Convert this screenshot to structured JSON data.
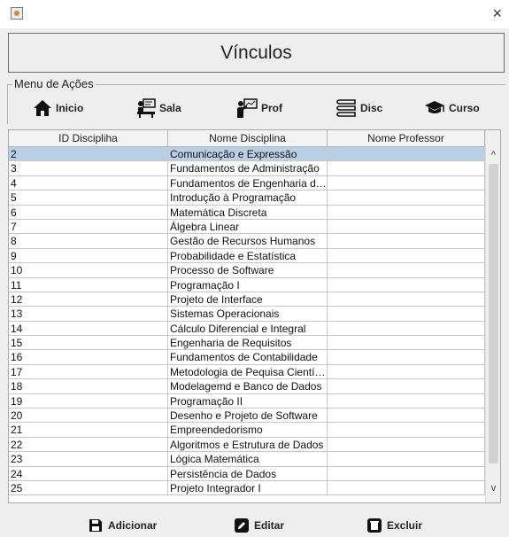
{
  "window": {
    "title": "Vínculos",
    "close_glyph": "×",
    "icon": "java-app-icon"
  },
  "menu": {
    "legend": "Menu de Ações",
    "buttons": [
      {
        "label": "Inicio",
        "icon": "home-icon"
      },
      {
        "label": "Sala",
        "icon": "classroom-icon"
      },
      {
        "label": "Prof",
        "icon": "teacher-icon"
      },
      {
        "label": "Disc",
        "icon": "books-icon"
      },
      {
        "label": "Curso",
        "icon": "graduation-cap-icon"
      }
    ]
  },
  "table": {
    "headers": [
      "ID Discipliha",
      "Nome Disciplina",
      "Nome Professor"
    ],
    "selected_row": 0,
    "rows": [
      [
        "2",
        "Comunicação e Expressão",
        ""
      ],
      [
        "3",
        "Fundamentos de Administração",
        ""
      ],
      [
        "4",
        "Fundamentos de Engenharia de Software",
        ""
      ],
      [
        "5",
        "Introdução à Programação",
        ""
      ],
      [
        "6",
        "Matemática Discreta",
        ""
      ],
      [
        "7",
        "Álgebra Linear",
        ""
      ],
      [
        "8",
        "Gestão de Recursos Humanos",
        ""
      ],
      [
        "9",
        "Probabilidade e Estatística",
        ""
      ],
      [
        "10",
        "Processo de Software",
        ""
      ],
      [
        "11",
        "Programação I",
        ""
      ],
      [
        "12",
        "Projeto de Interface",
        ""
      ],
      [
        "13",
        "Sistemas Operacionais",
        ""
      ],
      [
        "14",
        "Cálculo Diferencial e Integral",
        ""
      ],
      [
        "15",
        "Engenharia de Requisitos",
        ""
      ],
      [
        "16",
        "Fundamentos de Contabilidade",
        ""
      ],
      [
        "17",
        "Metodologia de Pequisa Científica",
        ""
      ],
      [
        "18",
        "Modelagemd e Banco de Dados",
        ""
      ],
      [
        "19",
        "Programação II",
        ""
      ],
      [
        "20",
        "Desenho e Projeto de Software",
        ""
      ],
      [
        "21",
        "Empreendedorismo",
        ""
      ],
      [
        "22",
        "Algoritmos e Estrutura de Dados",
        ""
      ],
      [
        "23",
        "Lógica Matemática",
        ""
      ],
      [
        "24",
        "Persistência de Dados",
        ""
      ],
      [
        "25",
        "Projeto Integrador I",
        ""
      ]
    ]
  },
  "scrollbar": {
    "up": "^",
    "down": "v"
  },
  "actions": {
    "add": {
      "label": "Adicionar",
      "icon": "save-icon"
    },
    "edit": {
      "label": "Editar",
      "icon": "pencil-icon"
    },
    "delete": {
      "label": "Excluir",
      "icon": "trash-icon"
    }
  },
  "colors": {
    "selection": "#b8cfe5",
    "background": "#eeeeee"
  }
}
